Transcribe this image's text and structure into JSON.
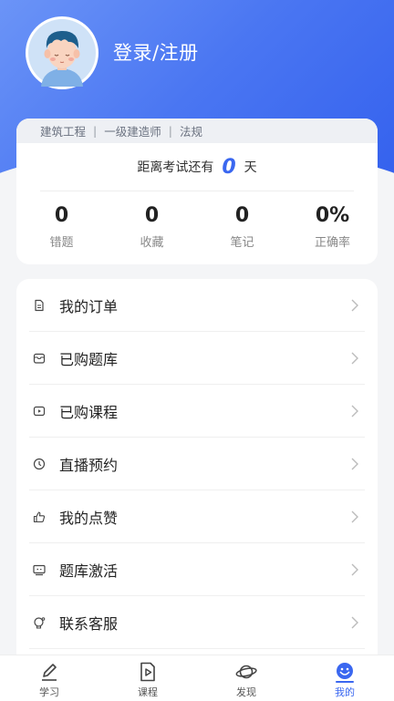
{
  "header": {
    "login_label": "登录/注册"
  },
  "exam": {
    "major": "建筑工程",
    "level": "一级建造师",
    "subject": "法规",
    "separator": "|",
    "countdown_prefix": "距离考试还有",
    "countdown_days": "0",
    "countdown_unit": "天"
  },
  "stats": [
    {
      "value": "0",
      "label": "错题"
    },
    {
      "value": "0",
      "label": "收藏"
    },
    {
      "value": "0",
      "label": "笔记"
    },
    {
      "value": "0%",
      "label": "正确率"
    }
  ],
  "menu": [
    {
      "label": "我的订单",
      "icon": "document-icon"
    },
    {
      "label": "已购题库",
      "icon": "box-icon"
    },
    {
      "label": "已购课程",
      "icon": "video-icon"
    },
    {
      "label": "直播预约",
      "icon": "clock-icon"
    },
    {
      "label": "我的点赞",
      "icon": "thumbs-up-icon"
    },
    {
      "label": "题库激活",
      "icon": "activation-icon"
    },
    {
      "label": "联系客服",
      "icon": "support-icon"
    }
  ],
  "tabs": [
    {
      "label": "学习",
      "icon": "pencil-icon",
      "active": false
    },
    {
      "label": "课程",
      "icon": "play-document-icon",
      "active": false
    },
    {
      "label": "发现",
      "icon": "planet-icon",
      "active": false
    },
    {
      "label": "我的",
      "icon": "smiley-icon",
      "active": true
    }
  ],
  "colors": {
    "accent": "#3a67f0",
    "header_start": "#6b94f7",
    "header_end": "#3562ee"
  }
}
